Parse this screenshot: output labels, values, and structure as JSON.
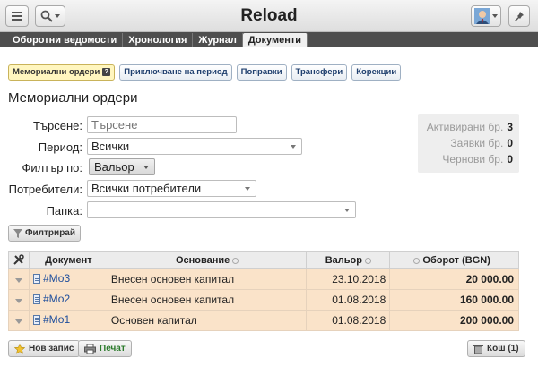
{
  "header": {
    "title": "Reload",
    "menu_icon": "hamburger-icon",
    "search_icon": "magnifier-icon",
    "user_icon": "user-avatar-icon",
    "pin_icon": "pushpin-icon"
  },
  "tabs": [
    {
      "label": "Оборотни ведомости",
      "active": false
    },
    {
      "label": "Хронология",
      "active": false
    },
    {
      "label": "Журнал",
      "active": false
    },
    {
      "label": "Документи",
      "active": true
    }
  ],
  "subtabs": [
    {
      "label": "Мемориални ордери",
      "active": true
    },
    {
      "label": "Приключване на период",
      "active": false
    },
    {
      "label": "Поправки",
      "active": false
    },
    {
      "label": "Трансфери",
      "active": false
    },
    {
      "label": "Корекции",
      "active": false
    }
  ],
  "help_mark": "?",
  "page_title": "Мемориални ордери",
  "form": {
    "search_label": "Търсене:",
    "search_placeholder": "Търсене",
    "period_label": "Период:",
    "period_value": "Всички",
    "filter_label": "Филтър по:",
    "filter_value": "Вальор",
    "users_label": "Потребители:",
    "users_value": "Всички потребители",
    "folder_label": "Папка:",
    "folder_value": ""
  },
  "stats": {
    "activated_label": "Активирани бр.",
    "activated_value": "3",
    "requests_label": "Заявки бр.",
    "requests_value": "0",
    "drafts_label": "Чернови бр.",
    "drafts_value": "0"
  },
  "filter_button": "Филтрирай",
  "table": {
    "headers": {
      "actions_icon": "tools-icon",
      "document": "Документ",
      "basis": "Основание",
      "date": "Вальор",
      "turnover": "Оборот (BGN)"
    },
    "rows": [
      {
        "doc": "#Мо3",
        "basis": "Внесен основен капитал",
        "date": "23.10.2018",
        "turnover": "20 000.00"
      },
      {
        "doc": "#Мо2",
        "basis": "Внесен основен капитал",
        "date": "01.08.2018",
        "turnover": "160 000.00"
      },
      {
        "doc": "#Мо1",
        "basis": "Основен капитал",
        "date": "01.08.2018",
        "turnover": "200 000.00"
      }
    ]
  },
  "bottom": {
    "new_label": "Нов запис",
    "print_label": "Печат",
    "trash_label": "Кош (1)"
  },
  "colors": {
    "accent_row": "#fae3c9",
    "tab_bar": "#4e4e4e",
    "link": "#1e4e9c"
  }
}
